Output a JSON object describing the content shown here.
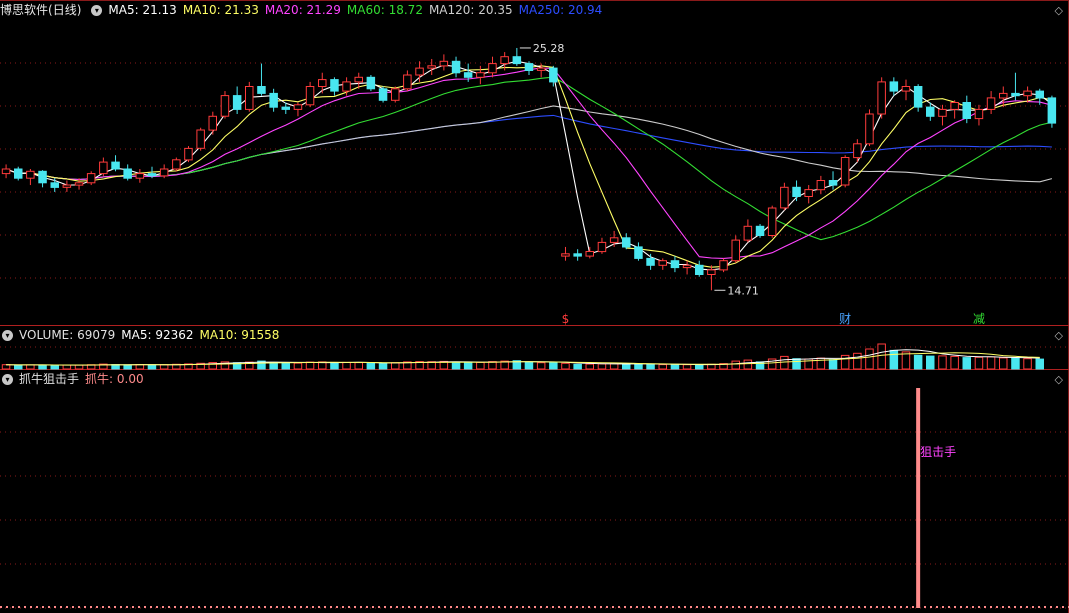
{
  "app": {
    "name": "博思软件",
    "period": "(日线)"
  },
  "colors": {
    "background": "#000000",
    "grid": "#8a1a1a",
    "up": "#ff3b3b",
    "down": "#49e6f0",
    "ma5": "#ffffff",
    "ma10": "#ffff66",
    "ma20": "#ff44ff",
    "ma60": "#33dd33",
    "ma120": "#cccccc",
    "ma250": "#2d4dff",
    "signal": "#ff8b8b",
    "signal_label": "#ff44ff"
  },
  "price_legend": {
    "ma5": "MA5: 21.13",
    "ma10": "MA10: 21.33",
    "ma20": "MA20: 21.29",
    "ma60": "MA60: 18.72",
    "ma120": "MA120: 20.35",
    "ma250": "MA250: 20.94"
  },
  "volume_legend": {
    "label": "VOLUME: 69079",
    "ma5": "MA5: 92362",
    "ma10": "MA10: 91558"
  },
  "indicator_legend": {
    "name": "抓牛狙击手",
    "value": "抓牛: 0.00"
  },
  "pane_controls": {
    "up": "◇",
    "down": "◇"
  },
  "chart_data": [
    {
      "type": "candlestick",
      "title": "",
      "ylim": [
        13.5,
        26.5
      ],
      "grid": true,
      "annotations": [
        {
          "text": "25.28",
          "index": 42,
          "price": 25.28,
          "kind": "high"
        },
        {
          "text": "14.71",
          "index": 58,
          "price": 14.71,
          "kind": "low"
        }
      ],
      "event_markers": [
        {
          "text": "$",
          "index": 46,
          "color": "#ff3b3b"
        },
        {
          "text": "财",
          "index": 69,
          "color": "#49a3ff"
        },
        {
          "text": "减",
          "index": 80,
          "color": "#33dd33"
        }
      ],
      "candles": [
        [
          19.8,
          20.2,
          19.6,
          20.0
        ],
        [
          20.0,
          20.1,
          19.5,
          19.6
        ],
        [
          19.6,
          20.0,
          19.3,
          19.9
        ],
        [
          19.9,
          19.95,
          19.2,
          19.4
        ],
        [
          19.4,
          19.6,
          19.0,
          19.2
        ],
        [
          19.2,
          19.5,
          19.0,
          19.3
        ],
        [
          19.3,
          19.6,
          19.1,
          19.4
        ],
        [
          19.4,
          19.9,
          19.3,
          19.8
        ],
        [
          19.8,
          20.5,
          19.7,
          20.3
        ],
        [
          20.3,
          20.6,
          19.9,
          20.0
        ],
        [
          20.0,
          20.2,
          19.5,
          19.6
        ],
        [
          19.6,
          20.0,
          19.4,
          19.8
        ],
        [
          19.8,
          20.1,
          19.6,
          19.7
        ],
        [
          19.7,
          20.2,
          19.6,
          20.0
        ],
        [
          20.0,
          20.5,
          19.9,
          20.4
        ],
        [
          20.4,
          21.0,
          20.3,
          20.9
        ],
        [
          20.9,
          21.8,
          20.8,
          21.7
        ],
        [
          21.7,
          22.5,
          21.5,
          22.3
        ],
        [
          22.3,
          23.4,
          22.2,
          23.2
        ],
        [
          23.2,
          23.6,
          22.4,
          22.6
        ],
        [
          22.6,
          23.8,
          22.5,
          23.6
        ],
        [
          23.6,
          24.6,
          23.2,
          23.3
        ],
        [
          23.3,
          23.5,
          22.5,
          22.7
        ],
        [
          22.7,
          22.9,
          22.4,
          22.6
        ],
        [
          22.6,
          22.9,
          22.3,
          22.8
        ],
        [
          22.8,
          23.8,
          22.7,
          23.6
        ],
        [
          23.6,
          24.2,
          23.3,
          23.9
        ],
        [
          23.9,
          24.0,
          23.2,
          23.4
        ],
        [
          23.4,
          24.0,
          23.2,
          23.8
        ],
        [
          23.8,
          24.2,
          23.5,
          24.0
        ],
        [
          24.0,
          24.1,
          23.4,
          23.5
        ],
        [
          23.5,
          23.6,
          22.9,
          23.0
        ],
        [
          23.0,
          23.6,
          22.9,
          23.5
        ],
        [
          23.5,
          24.3,
          23.4,
          24.1
        ],
        [
          24.1,
          24.7,
          23.8,
          24.4
        ],
        [
          24.4,
          24.8,
          24.1,
          24.5
        ],
        [
          24.5,
          25.0,
          24.3,
          24.7
        ],
        [
          24.7,
          24.9,
          24.0,
          24.2
        ],
        [
          24.2,
          24.6,
          23.8,
          24.0
        ],
        [
          24.0,
          24.5,
          23.7,
          24.2
        ],
        [
          24.2,
          24.9,
          24.0,
          24.6
        ],
        [
          24.6,
          25.1,
          24.3,
          24.9
        ],
        [
          24.9,
          25.28,
          24.5,
          24.6
        ],
        [
          24.6,
          24.7,
          24.1,
          24.3
        ],
        [
          24.3,
          24.6,
          24.0,
          24.4
        ],
        [
          24.4,
          24.5,
          23.6,
          23.8
        ],
        [
          16.2,
          16.6,
          16.0,
          16.3
        ],
        [
          16.3,
          16.5,
          16.0,
          16.2
        ],
        [
          16.2,
          16.6,
          16.1,
          16.4
        ],
        [
          16.4,
          17.0,
          16.3,
          16.8
        ],
        [
          16.8,
          17.3,
          16.6,
          17.0
        ],
        [
          17.0,
          17.2,
          16.5,
          16.6
        ],
        [
          16.6,
          16.8,
          16.0,
          16.1
        ],
        [
          16.1,
          16.3,
          15.6,
          15.8
        ],
        [
          15.8,
          16.1,
          15.6,
          16.0
        ],
        [
          16.0,
          16.2,
          15.5,
          15.7
        ],
        [
          15.7,
          16.0,
          15.4,
          15.8
        ],
        [
          15.8,
          16.0,
          15.3,
          15.4
        ],
        [
          15.4,
          15.8,
          14.71,
          15.6
        ],
        [
          15.6,
          16.1,
          15.5,
          16.0
        ],
        [
          16.0,
          17.1,
          15.9,
          16.9
        ],
        [
          16.9,
          17.8,
          16.8,
          17.5
        ],
        [
          17.5,
          17.6,
          17.0,
          17.1
        ],
        [
          17.1,
          18.4,
          17.0,
          18.3
        ],
        [
          18.3,
          19.4,
          18.2,
          19.2
        ],
        [
          19.2,
          19.5,
          18.6,
          18.8
        ],
        [
          18.8,
          19.3,
          18.5,
          19.1
        ],
        [
          19.1,
          19.7,
          18.9,
          19.5
        ],
        [
          19.5,
          19.9,
          19.1,
          19.3
        ],
        [
          19.3,
          20.6,
          19.2,
          20.5
        ],
        [
          20.5,
          21.3,
          20.3,
          21.1
        ],
        [
          21.1,
          22.6,
          21.0,
          22.4
        ],
        [
          22.4,
          24.0,
          22.2,
          23.8
        ],
        [
          23.8,
          24.0,
          23.2,
          23.4
        ],
        [
          23.4,
          23.9,
          23.0,
          23.6
        ],
        [
          23.6,
          23.7,
          22.5,
          22.7
        ],
        [
          22.7,
          22.9,
          22.1,
          22.3
        ],
        [
          22.3,
          22.8,
          21.9,
          22.6
        ],
        [
          22.6,
          23.0,
          22.2,
          22.9
        ],
        [
          22.9,
          23.2,
          22.0,
          22.2
        ],
        [
          22.2,
          22.8,
          21.9,
          22.6
        ],
        [
          22.6,
          23.4,
          22.4,
          23.1
        ],
        [
          23.1,
          23.6,
          22.7,
          23.3
        ],
        [
          23.3,
          24.2,
          23.0,
          23.2
        ],
        [
          23.2,
          23.6,
          22.9,
          23.4
        ],
        [
          23.4,
          23.5,
          22.8,
          23.1
        ],
        [
          23.1,
          23.2,
          21.8,
          22.0
        ]
      ]
    },
    {
      "type": "bar",
      "title": "VOLUME",
      "values": [
        30,
        28,
        29,
        27,
        26,
        28,
        27,
        30,
        34,
        31,
        29,
        30,
        29,
        30,
        33,
        36,
        40,
        45,
        50,
        44,
        48,
        55,
        46,
        40,
        41,
        48,
        50,
        44,
        46,
        45,
        42,
        38,
        44,
        50,
        52,
        51,
        53,
        47,
        45,
        46,
        52,
        55,
        58,
        48,
        44,
        45,
        40,
        32,
        34,
        36,
        38,
        36,
        34,
        33,
        31,
        32,
        30,
        29,
        33,
        38,
        55,
        62,
        50,
        70,
        88,
        72,
        70,
        76,
        66,
        95,
        110,
        140,
        175,
        130,
        120,
        96,
        90,
        92,
        88,
        80,
        82,
        85,
        78,
        76,
        72,
        69
      ],
      "ma5_color": "#ffffff",
      "ma10_color": "#ffff66"
    },
    {
      "type": "bar",
      "title": "抓牛狙击手",
      "signals": [
        {
          "index": 75,
          "value": 1,
          "label": "狙击手"
        }
      ],
      "ylim": [
        0,
        1
      ]
    }
  ]
}
